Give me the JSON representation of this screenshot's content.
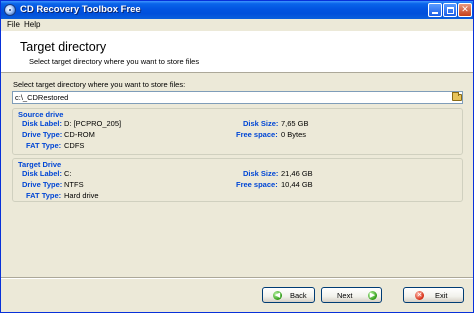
{
  "window": {
    "title": "CD Recovery Toolbox Free",
    "controls": {
      "minimize": "",
      "maximize": "",
      "close": "✕"
    }
  },
  "menu": {
    "items": [
      "File",
      "Help"
    ]
  },
  "header": {
    "title": "Target directory",
    "subtitle": "Select target directory where you want to store files"
  },
  "target_path": {
    "prompt": "Select target directory where you want to store files:",
    "value": "c:\\_CDRestored",
    "browse_icon": "folder-open-icon"
  },
  "source_drive": {
    "title": "Source drive",
    "disk_label_caption": "Disk Label:",
    "disk_label": "D: [PCPRO_205]",
    "drive_type_caption": "Drive Type:",
    "drive_type": "CD-ROM",
    "fat_type_caption": "FAT Type:",
    "fat_type": "CDFS",
    "disk_size_caption": "Disk Size:",
    "disk_size": "7,65 GB",
    "free_space_caption": "Free space:",
    "free_space": "0 Bytes"
  },
  "target_drive": {
    "title": "Target Drive",
    "disk_label_caption": "Disk Label:",
    "disk_label": "C:",
    "drive_type_caption": "Drive Type:",
    "drive_type": "NTFS",
    "fat_type_caption": "FAT Type:",
    "fat_type": "Hard drive",
    "disk_size_caption": "Disk Size:",
    "disk_size": "21,46 GB",
    "free_space_caption": "Free space:",
    "free_space": "10,44 GB"
  },
  "buttons": {
    "back": {
      "label": "Back",
      "icon": "arrow-left-icon",
      "glyph": "◀"
    },
    "next": {
      "label": "Next",
      "icon": "arrow-right-icon",
      "glyph": "▶"
    },
    "exit": {
      "label": "Exit",
      "icon": "exit-icon",
      "glyph": "✕"
    }
  },
  "colors": {
    "titlebar": "#0054e3",
    "field_label": "#0046d5",
    "background": "#ece9d8"
  }
}
